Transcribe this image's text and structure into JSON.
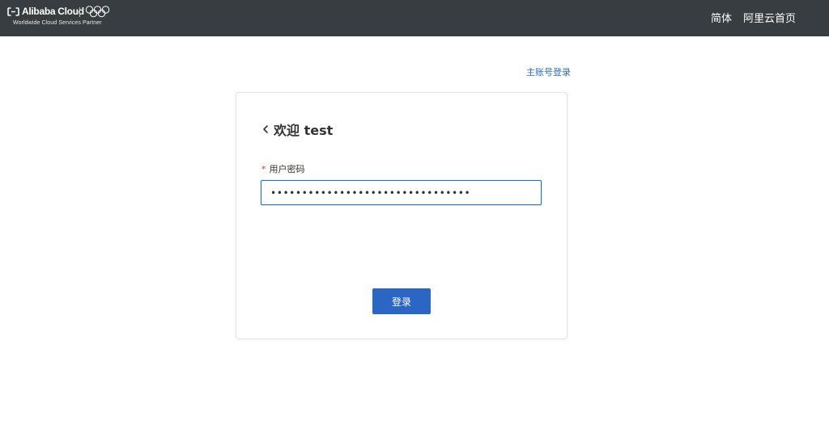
{
  "header": {
    "logo": {
      "brand_name": "Alibaba Cloud",
      "tagline": "Worldwide Cloud Services Partner",
      "mark_icon": "alibaba-cloud-mark-icon",
      "partner_icon": "olympic-rings-icon"
    },
    "nav": {
      "language_label": "简体",
      "home_label": "阿里云首页"
    },
    "background_color": "#373d41"
  },
  "page": {
    "main_account_login_label": "主账号登录"
  },
  "login_card": {
    "back_icon": "chevron-left-icon",
    "welcome_title": "欢迎 test",
    "password_field": {
      "required_mark": "*",
      "label": "用户密码",
      "value": "••••••••••••••••••••••••••••••••"
    },
    "submit_label": "登录"
  },
  "colors": {
    "accent": "#2b66c4",
    "link": "#2b6cc4",
    "required": "#e03a3a"
  }
}
